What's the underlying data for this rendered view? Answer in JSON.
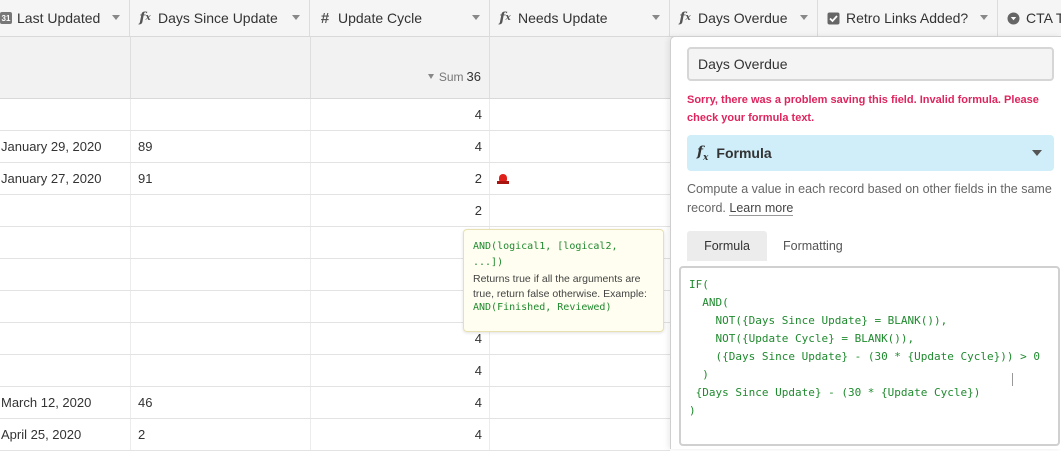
{
  "columns": [
    {
      "label": "Last Updated",
      "icon": "calendar-icon",
      "icon_text": "31"
    },
    {
      "label": "Days Since Update",
      "icon": "formula-icon"
    },
    {
      "label": "Update Cycle",
      "icon": "number-icon"
    },
    {
      "label": "Needs Update",
      "icon": "formula-icon"
    },
    {
      "label": "Days Overdue",
      "icon": "formula-icon"
    },
    {
      "label": "Retro Links Added?",
      "icon": "checkbox-icon"
    },
    {
      "label": "CTA Ty",
      "icon": "single-select-icon"
    }
  ],
  "summary": {
    "label": "Sum",
    "value": "36"
  },
  "rows": [
    {
      "last_updated": "",
      "days_since": "",
      "cycle": "4",
      "needs_update": false
    },
    {
      "last_updated": "January 29, 2020",
      "days_since": "89",
      "cycle": "4",
      "needs_update": false
    },
    {
      "last_updated": "January 27, 2020",
      "days_since": "91",
      "cycle": "2",
      "needs_update": true
    },
    {
      "last_updated": "",
      "days_since": "",
      "cycle": "2",
      "needs_update": false
    },
    {
      "last_updated": "",
      "days_since": "",
      "cycle": "",
      "needs_update": false
    },
    {
      "last_updated": "",
      "days_since": "",
      "cycle": "",
      "needs_update": false
    },
    {
      "last_updated": "",
      "days_since": "",
      "cycle": "",
      "needs_update": false
    },
    {
      "last_updated": "",
      "days_since": "",
      "cycle": "4",
      "needs_update": false
    },
    {
      "last_updated": "",
      "days_since": "",
      "cycle": "4",
      "needs_update": false
    },
    {
      "last_updated": "March 12, 2020",
      "days_since": "46",
      "cycle": "4",
      "needs_update": false
    },
    {
      "last_updated": "April 25, 2020",
      "days_since": "2",
      "cycle": "4",
      "needs_update": false
    }
  ],
  "tooltip": {
    "signature_line1": "AND(logical1, [logical2,",
    "signature_line2": "...])",
    "description": "Returns true if all the arguments are true, return false otherwise. Example:",
    "example": "AND(Finished, Reviewed)"
  },
  "panel": {
    "field_name": "Days Overdue",
    "error": "Sorry, there was a problem saving this field. Invalid formula. Please check your formula text.",
    "field_type": "Formula",
    "help_text": "Compute a value in each record based on other fields in the same record.",
    "learn_more": "Learn more",
    "tabs": [
      "Formula",
      "Formatting"
    ],
    "formula": "IF(\n  AND(\n    NOT({Days Since Update} = BLANK()),\n    NOT({Update Cycle} = BLANK()),\n    ({Days Since Update} - (30 * {Update Cycle})) > 0\n  )\n {Days Since Update} - (30 * {Update Cycle})\n)"
  },
  "colors": {
    "error": "#e0245e",
    "type_bg": "#cfeef9",
    "formula_text": "#1f8a2e",
    "siren": "#e0201a"
  }
}
